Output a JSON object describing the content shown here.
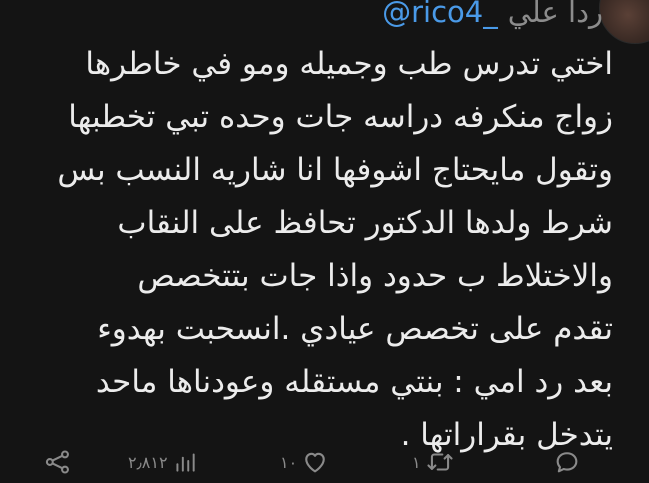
{
  "tweet": {
    "display_name": "ردا علي",
    "handle": "@rico4_",
    "body_lines": [
      "اختي تدرس طب وجميله ومو في خاطرها",
      "زواج منكرفه دراسه جات وحده تبي تخطبها",
      "وتقول مايحتاج اشوفها انا شاريه النسب بس",
      "شرط ولدها الدكتور  تحافظ على النقاب",
      "والاختلاط ب حدود واذا جات بتتخصص",
      "تقدم على تخصص عيادي .انسحبت بهدوء",
      "بعد رد امي :  بنتي مستقله وعودناها ماحد",
      "يتدخل بقراراتها ."
    ]
  },
  "actions": {
    "reply": {
      "icon": "reply-icon",
      "count": ""
    },
    "retweet": {
      "icon": "retweet-icon",
      "count": "١"
    },
    "like": {
      "icon": "heart-icon",
      "count": "١٠"
    },
    "views": {
      "icon": "views-chart-icon",
      "count": "٢٫٨١٢"
    },
    "share": {
      "icon": "share-icon",
      "count": ""
    }
  },
  "colors": {
    "background": "#141414",
    "text": "#ececec",
    "muted": "#8a8a8a",
    "handle": "#4a9ae8"
  }
}
